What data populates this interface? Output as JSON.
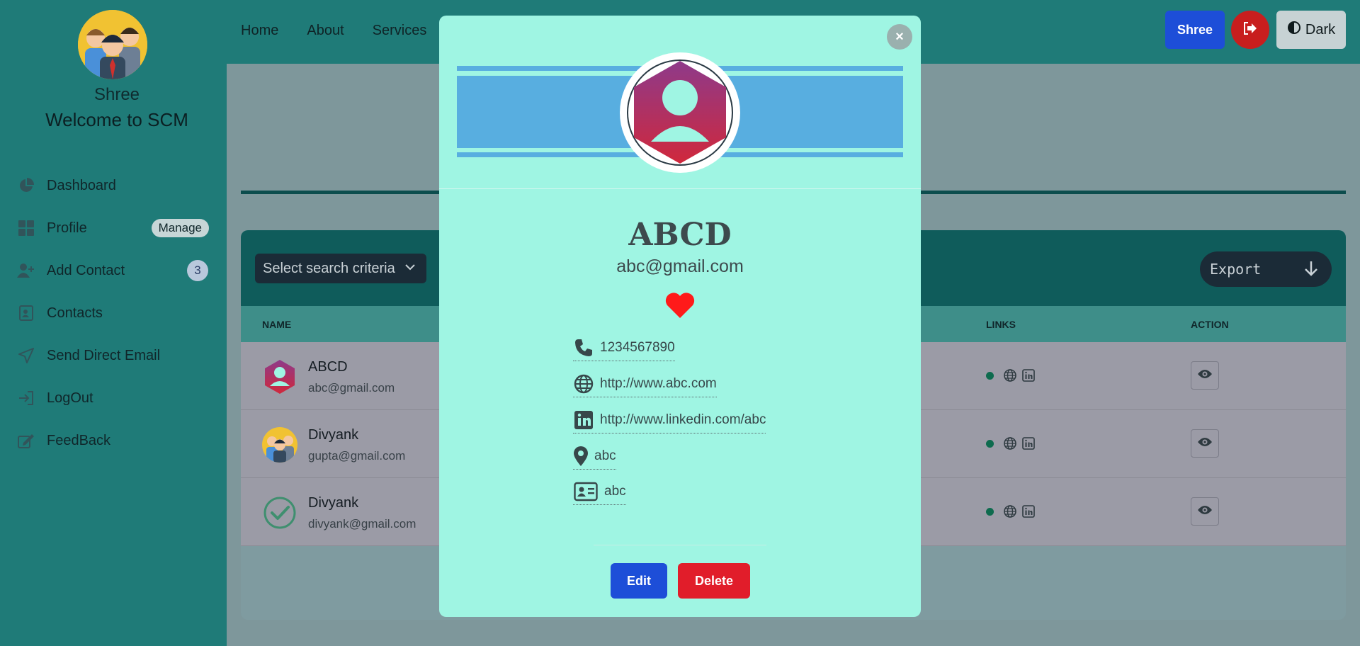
{
  "sidebar": {
    "user_name": "Shree",
    "welcome": "Welcome to SCM",
    "items": [
      {
        "label": "Dashboard",
        "icon": "pie-chart-icon"
      },
      {
        "label": "Profile",
        "icon": "grid-icon",
        "badge": "Manage"
      },
      {
        "label": "Add Contact",
        "icon": "user-plus-icon",
        "count": "3"
      },
      {
        "label": "Contacts",
        "icon": "contact-card-icon"
      },
      {
        "label": "Send Direct Email",
        "icon": "paper-plane-icon"
      },
      {
        "label": "LogOut",
        "icon": "logout-icon"
      },
      {
        "label": "FeedBack",
        "icon": "feedback-icon"
      }
    ]
  },
  "topbar": {
    "nav": [
      "Home",
      "About",
      "Services"
    ],
    "user_button": "Shree",
    "theme_button": "Dark"
  },
  "table": {
    "search_criteria_placeholder": "Select search criteria",
    "export_label": "Export",
    "headers": {
      "name": "NAME",
      "links": "LINKS",
      "action": "ACTION"
    },
    "rows": [
      {
        "name": "ABCD",
        "email": "abc@gmail.com",
        "avatar": "default-avatar"
      },
      {
        "name": "Divyank",
        "email": "gupta@gmail.com",
        "avatar": "team-avatar"
      },
      {
        "name": "Divyank",
        "email": "divyank@gmail.com",
        "avatar": "check-avatar"
      }
    ]
  },
  "modal": {
    "name": "ABCD",
    "email": "abc@gmail.com",
    "favorite": true,
    "phone": "1234567890",
    "website": "http://www.abc.com",
    "linkedin": "http://www.linkedin.com/abc",
    "address": "abc",
    "description": "abc",
    "edit_label": "Edit",
    "delete_label": "Delete",
    "close_glyph": "×"
  },
  "colors": {
    "sidebar_bg": "#1f7b78",
    "modal_bg": "#9ff5e3",
    "banner": "#58aee0",
    "primary": "#1d4ed8",
    "danger": "#e11d2a"
  }
}
